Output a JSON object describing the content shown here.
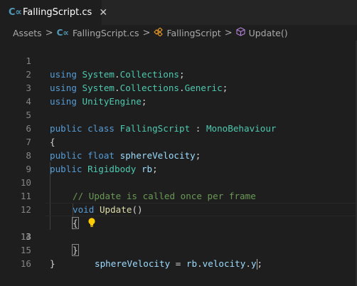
{
  "tab": {
    "label": "FallingScript.cs",
    "icon": "csharp-file-icon",
    "close": "✕"
  },
  "breadcrumb": {
    "items": [
      "Assets",
      "FallingScript.cs",
      "FallingScript",
      "Update()"
    ],
    "separator": ">"
  },
  "editor": {
    "line_numbers": [
      "1",
      "2",
      "3",
      "4",
      "5",
      "6",
      "7",
      "8",
      "9",
      "10",
      "11",
      "12",
      "13",
      "14",
      "15",
      "16"
    ],
    "active_line": "13",
    "lines": {
      "l1": [
        "using",
        " ",
        "System",
        ".",
        "Collections",
        ";"
      ],
      "l2": [
        "using",
        " ",
        "System",
        ".",
        "Collections",
        ".",
        "Generic",
        ";"
      ],
      "l3": [
        "using",
        " ",
        "UnityEngine",
        ";"
      ],
      "l5": [
        "public",
        " ",
        "class",
        " ",
        "FallingScript",
        " : ",
        "MonoBehaviour"
      ],
      "l6": [
        "{"
      ],
      "l7": [
        "public",
        " ",
        "float",
        " ",
        "sphereVelocity",
        ";"
      ],
      "l8": [
        "public",
        " ",
        "Rigidbody",
        " ",
        "rb",
        ";"
      ],
      "l10": [
        "// Update is called once per frame"
      ],
      "l11": [
        "void",
        " ",
        "Update",
        "()"
      ],
      "l12": [
        "{"
      ],
      "l13": [
        "sphereVelocity",
        " = ",
        "rb",
        ".",
        "velocity",
        ".",
        "y",
        ";"
      ],
      "l14": [
        "}"
      ],
      "l15": [
        "}"
      ]
    }
  },
  "colors": {
    "background": "#1e1e1e",
    "keyword": "#569cd6",
    "type": "#4ec9b0",
    "function": "#dcdcaa",
    "variable": "#9cdcfe",
    "comment": "#6a9955"
  }
}
